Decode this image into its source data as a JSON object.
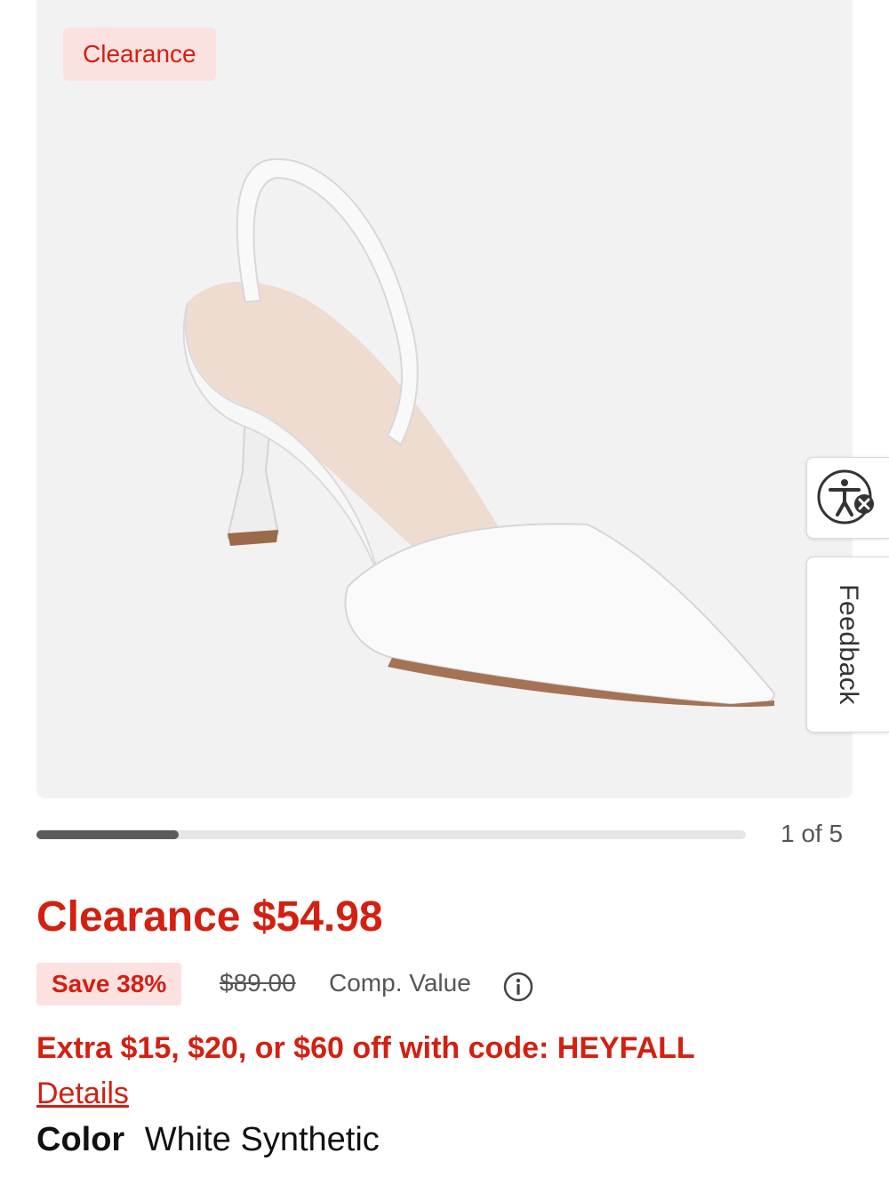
{
  "hero": {
    "badge": "Clearance",
    "image_alt": "white slingback pointed-toe pump"
  },
  "side_tabs": {
    "accessibility_icon": "accessibility-icon",
    "feedback_label": "Feedback"
  },
  "gallery": {
    "counter": "1 of 5",
    "progress_fraction": 0.2
  },
  "pricing": {
    "price": "Clearance $54.98",
    "save_badge": "Save 38%",
    "original_price": "$89.00",
    "comp_label": "Comp. Value",
    "info_icon": "info-icon"
  },
  "promo": {
    "text": "Extra $15, $20, or $60 off with code: HEYFALL",
    "details_link": "Details"
  },
  "color": {
    "label": "Color",
    "value": "White Synthetic"
  },
  "colors": {
    "accent_red": "#d32011",
    "badge_bg": "#fce1e1",
    "hero_bg": "#f2f2f2"
  }
}
